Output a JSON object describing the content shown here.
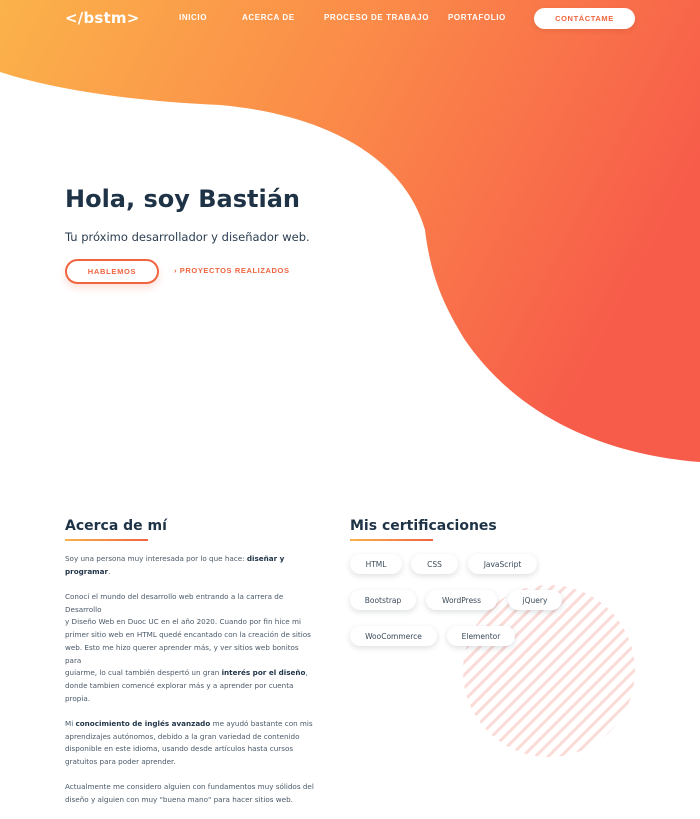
{
  "nav": {
    "logo": "</bstm>",
    "links": [
      "INICIO",
      "ACERCA DE",
      "PROCESO DE TRABAJO",
      "PORTAFOLIO"
    ],
    "cta": "CONTÁCTAME"
  },
  "hero": {
    "title": "Hola, soy Bastián",
    "subtitle": "Tu próximo desarrollador y diseñador web.",
    "primary_button": "HABLEMOS",
    "secondary_link": "› PROYECTOS REALIZADOS"
  },
  "about": {
    "title": "Acerca de mí",
    "p1_pre": "Soy una persona muy interesada por lo que hace: ",
    "p1_bold": "diseñar y programar",
    "p1_post": ".",
    "p2_line1": "Conocí el mundo del desarrollo web entrando a la carrera de Desarrollo",
    "p2_line2": "y Diseño Web en Duoc UC en el año 2020. Cuando por fin hice mi",
    "p2_line3": "primer sitio web en HTML quedé encantado con la creación de sitios",
    "p2_line4": "web. Esto me hizo querer aprender más, y ver sitios web bonitos para",
    "p2_line5_pre": "guiarme, lo cual también despertó un gran ",
    "p2_line5_bold": "interés por el diseño",
    "p2_line5_post": ",",
    "p2_line6": "donde tambien comencé explorar más y a aprender por cuenta propia.",
    "p3_line1_pre": "Mi ",
    "p3_line1_bold": "conocimiento de inglés avanzado",
    "p3_line1_post": " me ayudó bastante con mis",
    "p3_line2": "aprendizajes autónomos, debido a la gran variedad de contenido",
    "p3_line3": "disponible en este idioma, usando desde artículos hasta cursos",
    "p3_line4": "gratuitos para poder aprender.",
    "p4_line1": "Actualmente me considero alguien con fundamentos muy sólidos del",
    "p4_line2": "diseño y alguien con muy \"buena mano\" para hacer sitios web."
  },
  "certs": {
    "title": "Mis certificaciones",
    "items": [
      "HTML",
      "CSS",
      "JavaScript",
      "Bootstrap",
      "WordPress",
      "jQuery",
      "WooCommerce",
      "Elementor"
    ]
  },
  "colors": {
    "gradient_start": "#fbb24a",
    "gradient_end": "#f75c4a",
    "accent": "#f0643f",
    "heading": "#1f3347"
  }
}
